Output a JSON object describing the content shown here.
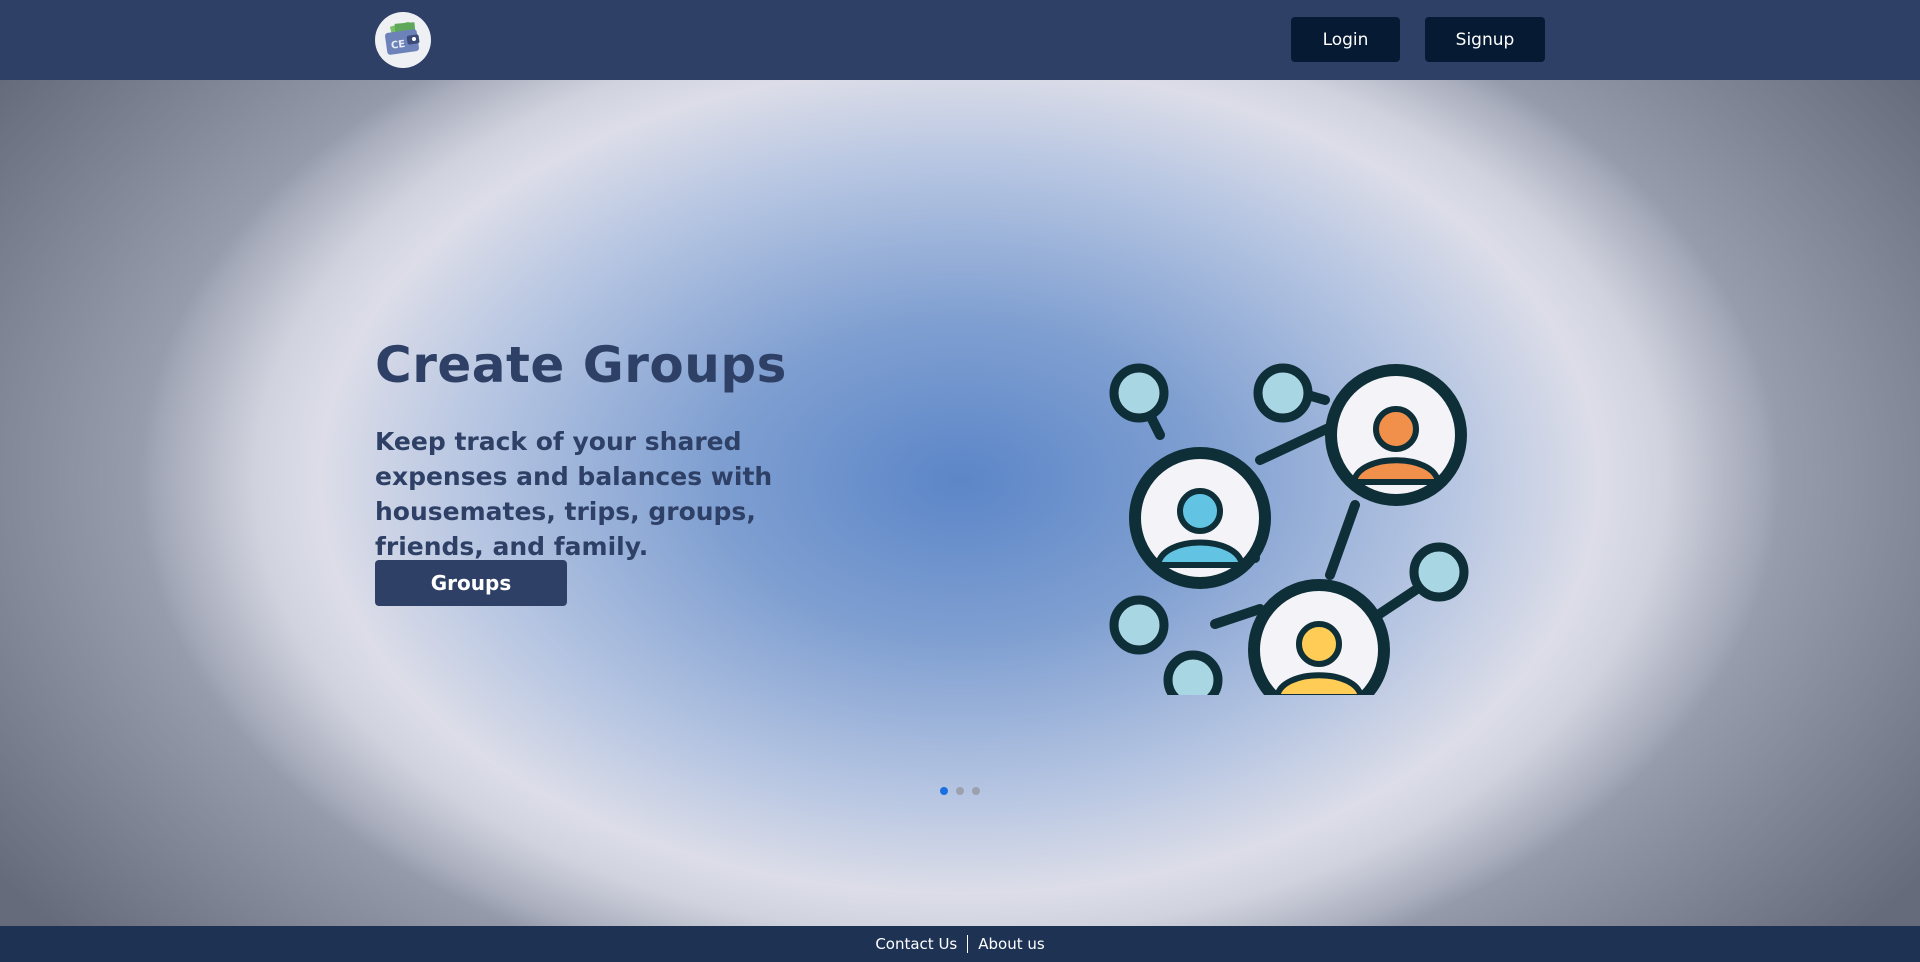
{
  "navbar": {
    "logo_icon": "wallet-logo-icon",
    "logo_text": "CE",
    "login_label": "Login",
    "signup_label": "Signup"
  },
  "hero": {
    "title": "Create Groups",
    "text": "Keep track of your shared expenses and balances with housemates, trips, groups, friends, and family.",
    "button_label": "Groups",
    "illustration_icon": "user-network-icon",
    "indicators": {
      "count": 3,
      "active_index": 0
    }
  },
  "footer": {
    "contact_label": "Contact Us",
    "about_label": "About us"
  },
  "colors": {
    "navbar": "#2e4066",
    "button_dark": "#061b33",
    "title": "#2e4066",
    "footer": "#1e3354",
    "indicator_active": "#1a6fe0"
  }
}
